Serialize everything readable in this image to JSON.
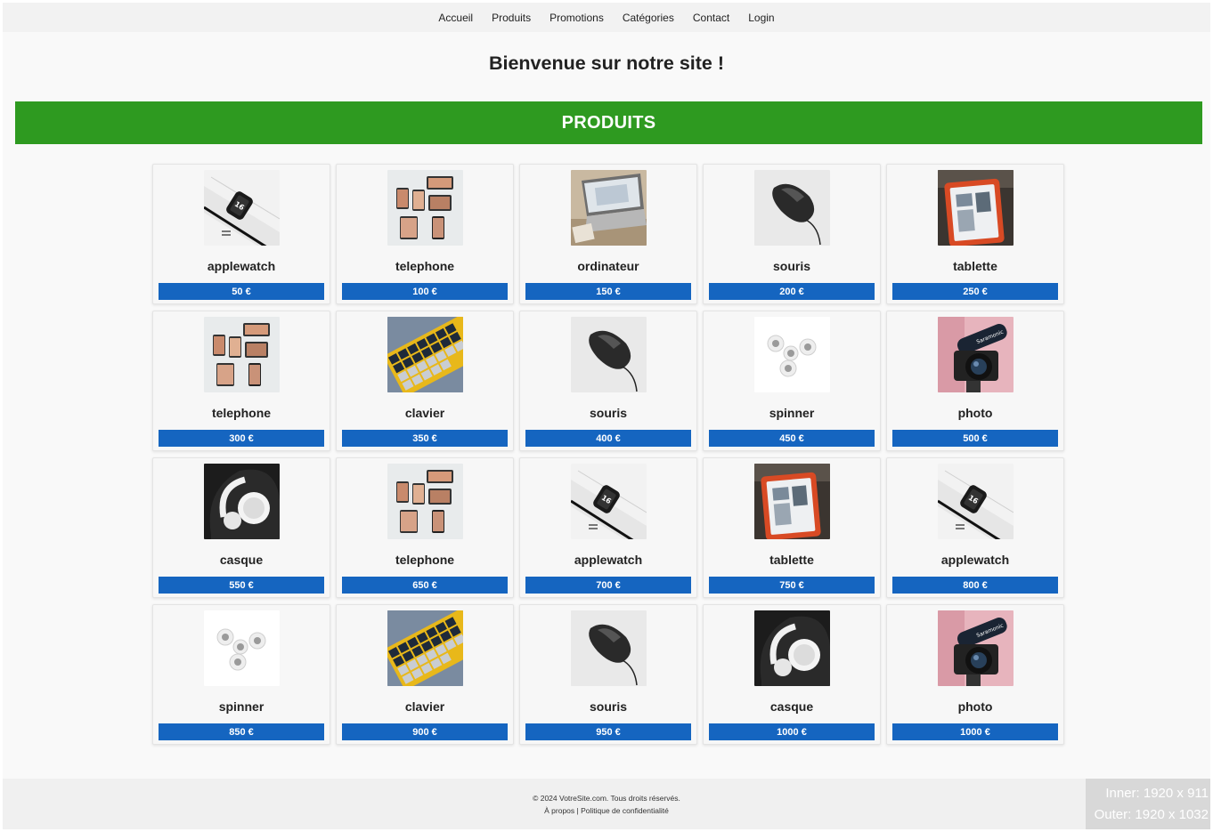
{
  "nav": {
    "items": [
      {
        "label": "Accueil"
      },
      {
        "label": "Produits"
      },
      {
        "label": "Promotions"
      },
      {
        "label": "Catégories"
      },
      {
        "label": "Contact"
      },
      {
        "label": "Login"
      }
    ]
  },
  "page": {
    "title": "Bienvenue sur notre site !",
    "section_title": "PRODUITS"
  },
  "products": [
    {
      "name": "applewatch",
      "price": "50 €",
      "image": "applewatch"
    },
    {
      "name": "telephone",
      "price": "100 €",
      "image": "telephone"
    },
    {
      "name": "ordinateur",
      "price": "150 €",
      "image": "ordinateur"
    },
    {
      "name": "souris",
      "price": "200 €",
      "image": "souris"
    },
    {
      "name": "tablette",
      "price": "250 €",
      "image": "tablette"
    },
    {
      "name": "telephone",
      "price": "300 €",
      "image": "telephone"
    },
    {
      "name": "clavier",
      "price": "350 €",
      "image": "clavier"
    },
    {
      "name": "souris",
      "price": "400 €",
      "image": "souris"
    },
    {
      "name": "spinner",
      "price": "450 €",
      "image": "spinner"
    },
    {
      "name": "photo",
      "price": "500 €",
      "image": "photo"
    },
    {
      "name": "casque",
      "price": "550 €",
      "image": "casque"
    },
    {
      "name": "telephone",
      "price": "650 €",
      "image": "telephone"
    },
    {
      "name": "applewatch",
      "price": "700 €",
      "image": "applewatch"
    },
    {
      "name": "tablette",
      "price": "750 €",
      "image": "tablette"
    },
    {
      "name": "applewatch",
      "price": "800 €",
      "image": "applewatch"
    },
    {
      "name": "spinner",
      "price": "850 €",
      "image": "spinner"
    },
    {
      "name": "clavier",
      "price": "900 €",
      "image": "clavier"
    },
    {
      "name": "souris",
      "price": "950 €",
      "image": "souris"
    },
    {
      "name": "casque",
      "price": "1000 €",
      "image": "casque"
    },
    {
      "name": "photo",
      "price": "1000 €",
      "image": "photo"
    }
  ],
  "footer": {
    "copyright": "© 2024 VotreSite.com. Tous droits réservés.",
    "about": "À propos",
    "separator": " | ",
    "privacy": "Politique de confidentialité"
  },
  "overlay": {
    "inner": "Inner: 1920 x 911",
    "outer": "Outer: 1920 x 1032"
  },
  "colors": {
    "banner": "#2e9a20",
    "price_bar": "#1565c0"
  }
}
